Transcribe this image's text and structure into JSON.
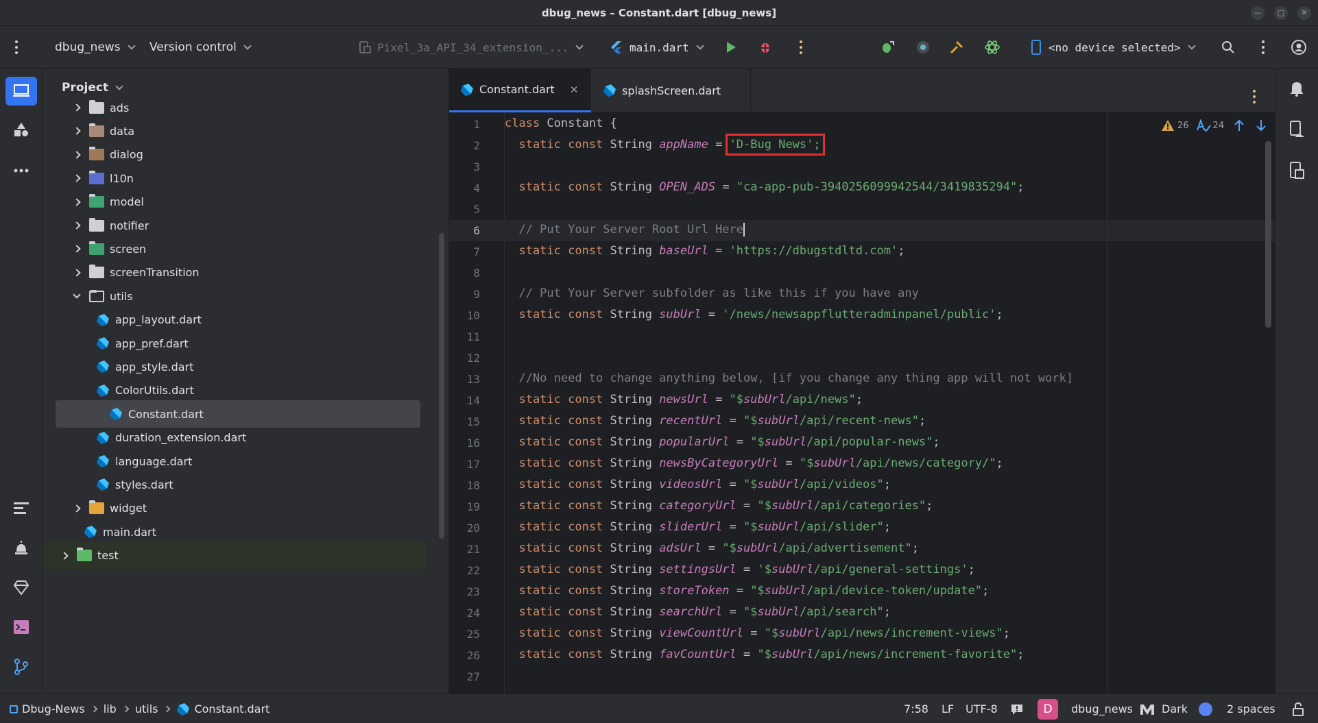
{
  "window": {
    "title": "dbug_news – Constant.dart [dbug_news]"
  },
  "toolbar": {
    "project_name": "dbug_news",
    "vcs": "Version control",
    "device_config": "Pixel_3a_API_34_extension_...",
    "run_config": "main.dart",
    "device_selector": "<no device selected>"
  },
  "project_panel": {
    "title": "Project",
    "items": [
      {
        "label": "ads",
        "kind": "folder",
        "state": "collapsed"
      },
      {
        "label": "data",
        "kind": "folder",
        "state": "collapsed"
      },
      {
        "label": "dialog",
        "kind": "folder",
        "state": "collapsed"
      },
      {
        "label": "l10n",
        "kind": "folder",
        "state": "collapsed"
      },
      {
        "label": "model",
        "kind": "folder",
        "state": "collapsed"
      },
      {
        "label": "notifier",
        "kind": "folder",
        "state": "collapsed"
      },
      {
        "label": "screen",
        "kind": "folder",
        "state": "collapsed"
      },
      {
        "label": "screenTransition",
        "kind": "folder",
        "state": "collapsed"
      },
      {
        "label": "utils",
        "kind": "folder",
        "state": "expanded"
      },
      {
        "label": "app_layout.dart",
        "kind": "dart"
      },
      {
        "label": "app_pref.dart",
        "kind": "dart"
      },
      {
        "label": "app_style.dart",
        "kind": "dart"
      },
      {
        "label": "ColorUtils.dart",
        "kind": "dart"
      },
      {
        "label": "Constant.dart",
        "kind": "dart",
        "selected": true
      },
      {
        "label": "duration_extension.dart",
        "kind": "dart"
      },
      {
        "label": "language.dart",
        "kind": "dart"
      },
      {
        "label": "styles.dart",
        "kind": "dart"
      },
      {
        "label": "widget",
        "kind": "folder",
        "state": "collapsed"
      },
      {
        "label": "main.dart",
        "kind": "dart"
      },
      {
        "label": "test",
        "kind": "folder",
        "state": "collapsed"
      }
    ]
  },
  "editor": {
    "tabs": [
      {
        "label": "Constant.dart",
        "active": true
      },
      {
        "label": "splashScreen.dart",
        "active": false
      }
    ],
    "inspections": {
      "warnings": "26",
      "typos": "24"
    },
    "current_line": 6,
    "lines": [
      {
        "n": "1",
        "parts": [
          [
            "kw",
            "class "
          ],
          [
            "typ",
            "Constant {"
          ]
        ]
      },
      {
        "n": "2",
        "parts": [
          [
            "kw",
            "  static const "
          ],
          [
            "typ",
            "String "
          ],
          [
            "fld",
            "appName"
          ],
          [
            "typ",
            " = "
          ],
          [
            "strbox",
            "'D-Bug News';"
          ]
        ]
      },
      {
        "n": "3",
        "parts": []
      },
      {
        "n": "4",
        "parts": [
          [
            "kw",
            "  static const "
          ],
          [
            "typ",
            "String "
          ],
          [
            "fld",
            "OPEN_ADS"
          ],
          [
            "typ",
            " = "
          ],
          [
            "str",
            "\"ca-app-pub-3940256099942544/3419835294\""
          ],
          [
            "typ",
            ";"
          ]
        ]
      },
      {
        "n": "5",
        "parts": []
      },
      {
        "n": "6",
        "parts": [
          [
            "cmt",
            "  // Put Your Server Root Url Here"
          ]
        ]
      },
      {
        "n": "7",
        "parts": [
          [
            "kw",
            "  static const "
          ],
          [
            "typ",
            "String "
          ],
          [
            "fld",
            "baseUrl"
          ],
          [
            "typ",
            " = "
          ],
          [
            "str",
            "'https://dbugstdltd.com'"
          ],
          [
            "typ",
            ";"
          ]
        ]
      },
      {
        "n": "8",
        "parts": []
      },
      {
        "n": "9",
        "parts": [
          [
            "cmt",
            "  // Put Your Server subfolder as like this if you have any"
          ]
        ]
      },
      {
        "n": "10",
        "parts": [
          [
            "kw",
            "  static const "
          ],
          [
            "typ",
            "String "
          ],
          [
            "fld",
            "subUrl"
          ],
          [
            "typ",
            " = "
          ],
          [
            "str",
            "'/news/newsappflutteradminpanel/public'"
          ],
          [
            "typ",
            ";"
          ]
        ]
      },
      {
        "n": "11",
        "parts": []
      },
      {
        "n": "12",
        "parts": []
      },
      {
        "n": "13",
        "parts": [
          [
            "cmt",
            "  //No need to change anything below, [if you change any thing app will not work]"
          ]
        ]
      },
      {
        "n": "14",
        "parts": [
          [
            "kw",
            "  static const "
          ],
          [
            "typ",
            "String "
          ],
          [
            "fld",
            "newsUrl"
          ],
          [
            "typ",
            " = "
          ],
          [
            "str",
            "\"$"
          ],
          [
            "fld",
            "subUrl"
          ],
          [
            "str",
            "/api/news\""
          ],
          [
            "typ",
            ";"
          ]
        ]
      },
      {
        "n": "15",
        "parts": [
          [
            "kw",
            "  static const "
          ],
          [
            "typ",
            "String "
          ],
          [
            "fld",
            "recentUrl"
          ],
          [
            "typ",
            " = "
          ],
          [
            "str",
            "\"$"
          ],
          [
            "fld",
            "subUrl"
          ],
          [
            "str",
            "/api/recent-news\""
          ],
          [
            "typ",
            ";"
          ]
        ]
      },
      {
        "n": "16",
        "parts": [
          [
            "kw",
            "  static const "
          ],
          [
            "typ",
            "String "
          ],
          [
            "fld",
            "popularUrl"
          ],
          [
            "typ",
            " = "
          ],
          [
            "str",
            "\"$"
          ],
          [
            "fld",
            "subUrl"
          ],
          [
            "str",
            "/api/popular-news\""
          ],
          [
            "typ",
            ";"
          ]
        ]
      },
      {
        "n": "17",
        "parts": [
          [
            "kw",
            "  static const "
          ],
          [
            "typ",
            "String "
          ],
          [
            "fld",
            "newsByCategoryUrl"
          ],
          [
            "typ",
            " = "
          ],
          [
            "str",
            "\"$"
          ],
          [
            "fld",
            "subUrl"
          ],
          [
            "str",
            "/api/news/category/\""
          ],
          [
            "typ",
            ";"
          ]
        ]
      },
      {
        "n": "18",
        "parts": [
          [
            "kw",
            "  static const "
          ],
          [
            "typ",
            "String "
          ],
          [
            "fld",
            "videosUrl"
          ],
          [
            "typ",
            " = "
          ],
          [
            "str",
            "\"$"
          ],
          [
            "fld",
            "subUrl"
          ],
          [
            "str",
            "/api/videos\""
          ],
          [
            "typ",
            ";"
          ]
        ]
      },
      {
        "n": "19",
        "parts": [
          [
            "kw",
            "  static const "
          ],
          [
            "typ",
            "String "
          ],
          [
            "fld",
            "categoryUrl"
          ],
          [
            "typ",
            " = "
          ],
          [
            "str",
            "\"$"
          ],
          [
            "fld",
            "subUrl"
          ],
          [
            "str",
            "/api/categories\""
          ],
          [
            "typ",
            ";"
          ]
        ]
      },
      {
        "n": "20",
        "parts": [
          [
            "kw",
            "  static const "
          ],
          [
            "typ",
            "String "
          ],
          [
            "fld",
            "sliderUrl"
          ],
          [
            "typ",
            " = "
          ],
          [
            "str",
            "\"$"
          ],
          [
            "fld",
            "subUrl"
          ],
          [
            "str",
            "/api/slider\""
          ],
          [
            "typ",
            ";"
          ]
        ]
      },
      {
        "n": "21",
        "parts": [
          [
            "kw",
            "  static const "
          ],
          [
            "typ",
            "String "
          ],
          [
            "fld",
            "adsUrl"
          ],
          [
            "typ",
            " = "
          ],
          [
            "str",
            "\"$"
          ],
          [
            "fld",
            "subUrl"
          ],
          [
            "str",
            "/api/advertisement\""
          ],
          [
            "typ",
            ";"
          ]
        ]
      },
      {
        "n": "22",
        "parts": [
          [
            "kw",
            "  static const "
          ],
          [
            "typ",
            "String "
          ],
          [
            "fld",
            "settingsUrl"
          ],
          [
            "typ",
            " = "
          ],
          [
            "str",
            "'$"
          ],
          [
            "fld",
            "subUrl"
          ],
          [
            "str",
            "/api/general-settings'"
          ],
          [
            "typ",
            ";"
          ]
        ]
      },
      {
        "n": "23",
        "parts": [
          [
            "kw",
            "  static const "
          ],
          [
            "typ",
            "String "
          ],
          [
            "fld",
            "storeToken"
          ],
          [
            "typ",
            " = "
          ],
          [
            "str",
            "\"$"
          ],
          [
            "fld",
            "subUrl"
          ],
          [
            "str",
            "/api/device-token/update\""
          ],
          [
            "typ",
            ";"
          ]
        ]
      },
      {
        "n": "24",
        "parts": [
          [
            "kw",
            "  static const "
          ],
          [
            "typ",
            "String "
          ],
          [
            "fld",
            "searchUrl"
          ],
          [
            "typ",
            " = "
          ],
          [
            "str",
            "\"$"
          ],
          [
            "fld",
            "subUrl"
          ],
          [
            "str",
            "/api/search\""
          ],
          [
            "typ",
            ";"
          ]
        ]
      },
      {
        "n": "25",
        "parts": [
          [
            "kw",
            "  static const "
          ],
          [
            "typ",
            "String "
          ],
          [
            "fld",
            "viewCountUrl"
          ],
          [
            "typ",
            " = "
          ],
          [
            "str",
            "\"$"
          ],
          [
            "fld",
            "subUrl"
          ],
          [
            "str",
            "/api/news/increment-views\""
          ],
          [
            "typ",
            ";"
          ]
        ]
      },
      {
        "n": "26",
        "parts": [
          [
            "kw",
            "  static const "
          ],
          [
            "typ",
            "String "
          ],
          [
            "fld",
            "favCountUrl"
          ],
          [
            "typ",
            " = "
          ],
          [
            "str",
            "\"$"
          ],
          [
            "fld",
            "subUrl"
          ],
          [
            "str",
            "/api/news/increment-favorite\""
          ],
          [
            "typ",
            ";"
          ]
        ]
      },
      {
        "n": "27",
        "parts": []
      }
    ]
  },
  "statusbar": {
    "breadcrumb": [
      "Dbug-News",
      "lib",
      "utils",
      "Constant.dart"
    ],
    "position": "7:58",
    "line_sep": "LF",
    "encoding": "UTF-8",
    "avatar_letter": "D",
    "project": "dbug_news",
    "theme": "Dark",
    "indent": "2 spaces"
  },
  "colors": {
    "accent": "#3574f0",
    "highlight_box": "#e03131",
    "selection": "#43454a"
  }
}
